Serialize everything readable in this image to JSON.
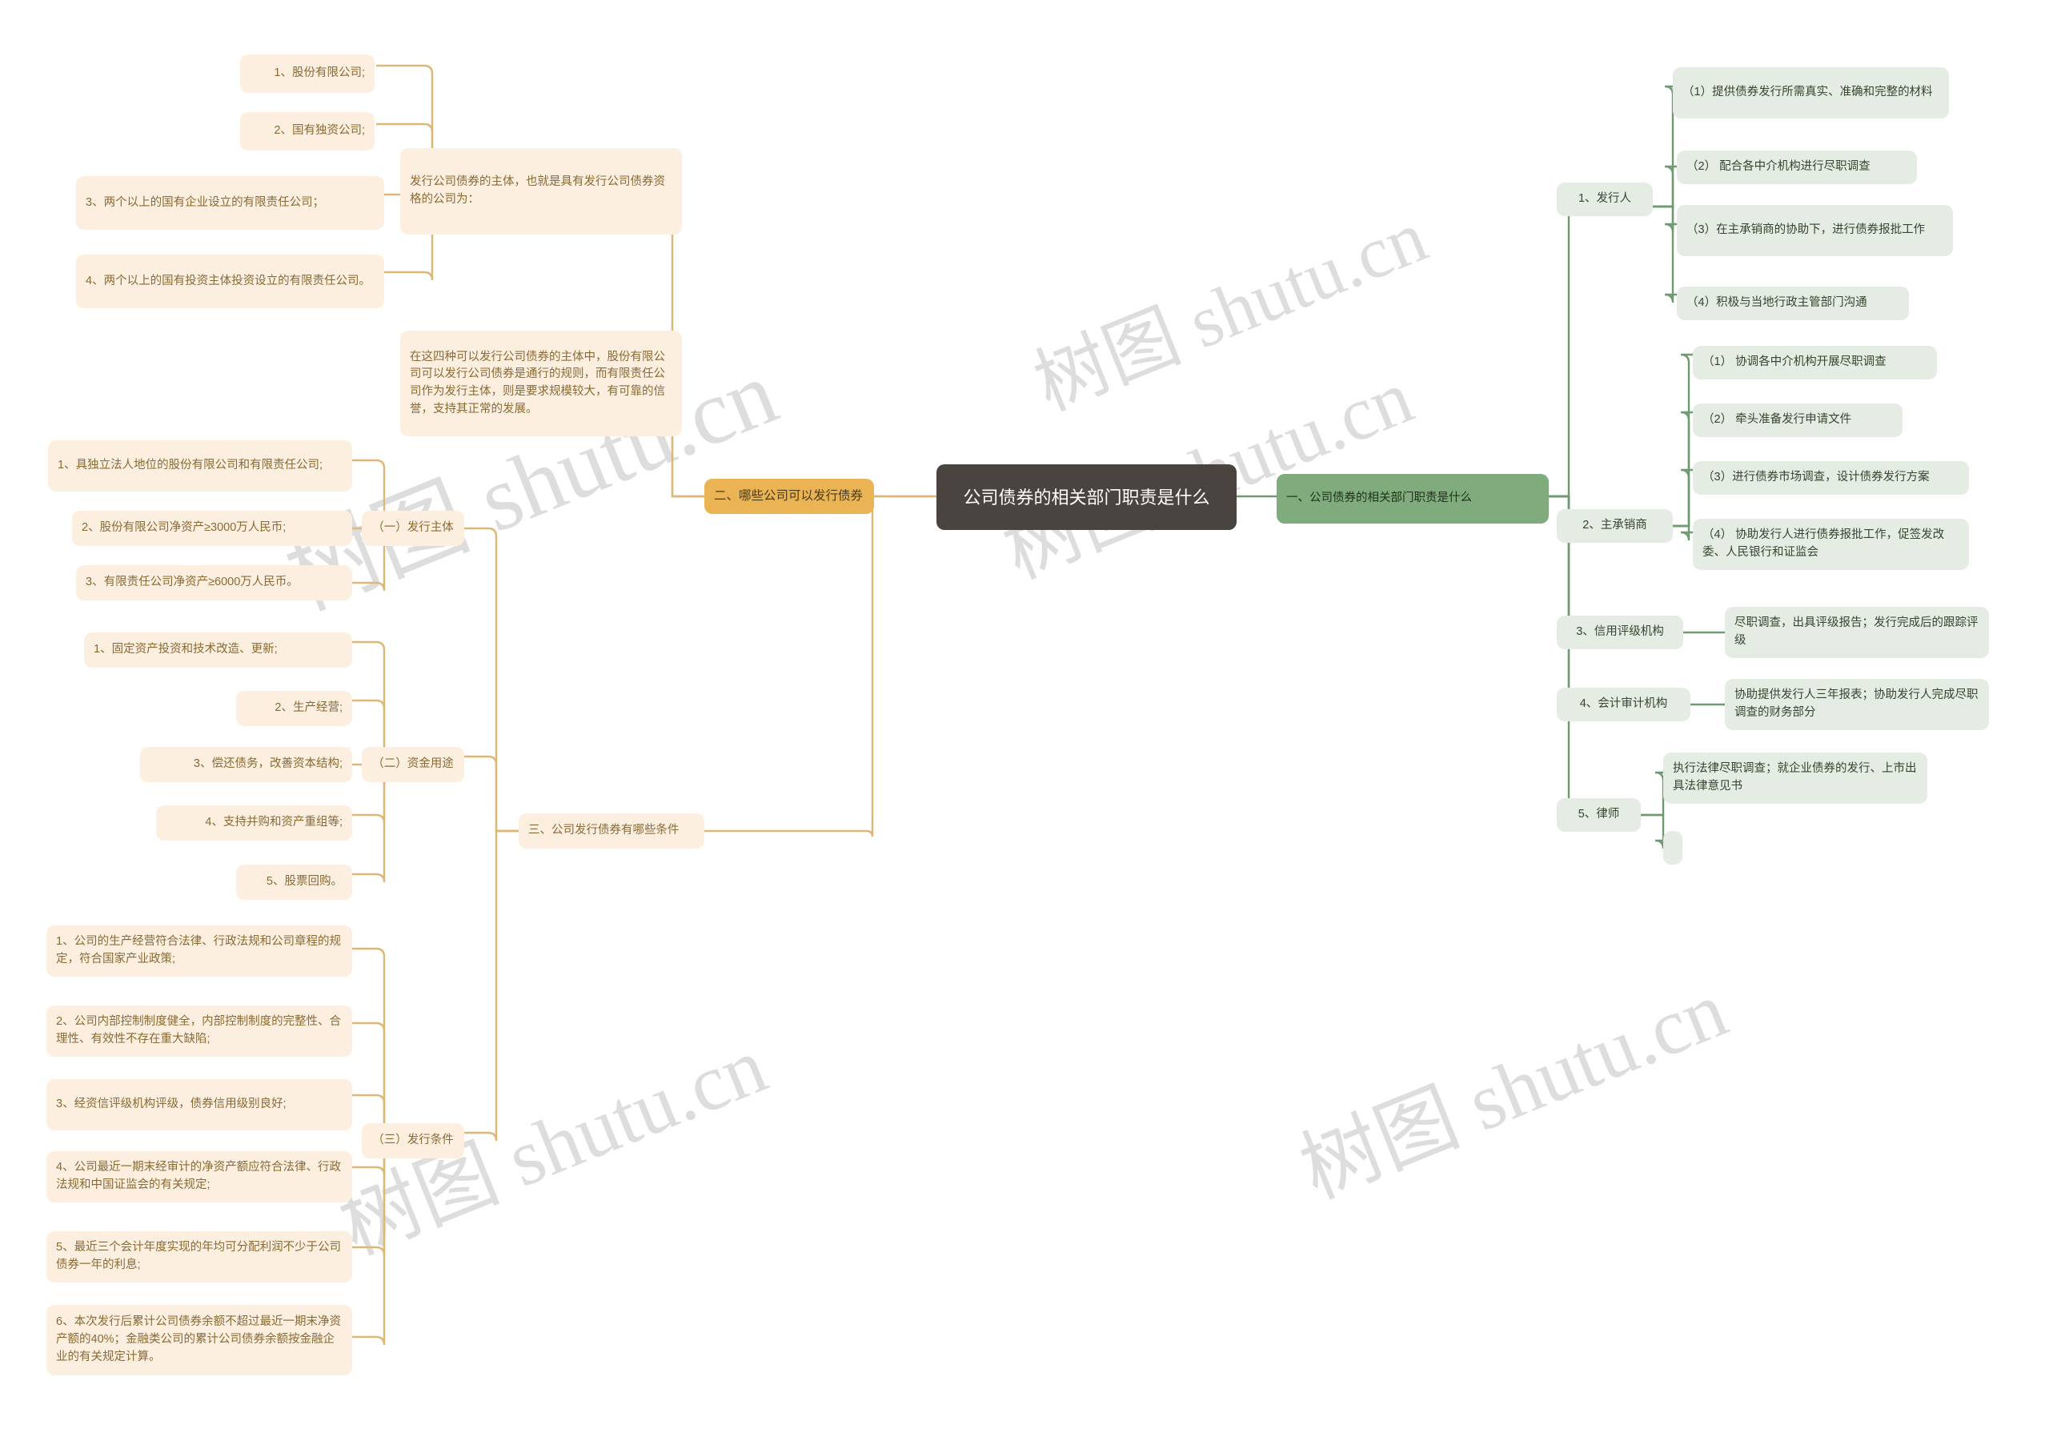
{
  "meta": {
    "watermark_text": "树图 shutu.cn"
  },
  "root": {
    "label": "公司债券的相关部门职责是什么"
  },
  "branches": {
    "left": {
      "label": "二、哪些公司可以发行债券",
      "label3": "三、公司发行债券有哪些条件",
      "subject_group": {
        "label": "发行公司债券的主体，也就是具有发行公司债券资格的公司为：",
        "items": [
          "1、股份有限公司;",
          "2、国有独资公司;",
          "3、两个以上的国有企业设立的有限责任公司；",
          "4、两个以上的国有投资主体投资设立的有限责任公司。"
        ],
        "note": "在这四种可以发行公司债券的主体中，股份有限公司可以发行公司债券是通行的规则，而有限责任公司作为发行主体，则是要求规模较大，有可靠的信誉，支持其正常的发展。"
      },
      "issuer_group": {
        "label": "（一）发行主体",
        "items": [
          "1、具独立法人地位的股份有限公司和有限责任公司;",
          "2、股份有限公司净资产≥3000万人民币;",
          "3、有限责任公司净资产≥6000万人民币。"
        ]
      },
      "funds_group": {
        "label": "（二）资金用途",
        "items": [
          "1、固定资产投资和技术改造、更新;",
          "2、生产经营;",
          "3、偿还债务，改善资本结构;",
          "4、支持并购和资产重组等;",
          "5、股票回购。"
        ]
      },
      "conditions_group": {
        "label": "（三）发行条件",
        "items": [
          "1、公司的生产经营符合法律、行政法规和公司章程的规定，符合国家产业政策;",
          "2、公司内部控制制度健全，内部控制制度的完整性、合理性、有效性不存在重大缺陷;",
          "3、经资信评级机构评级，债券信用级别良好;",
          "4、公司最近一期末经审计的净资产额应符合法律、行政法规和中国证监会的有关规定;",
          "5、最近三个会计年度实现的年均可分配利润不少于公司债券一年的利息;",
          "6、本次发行后累计公司债券余额不超过最近一期末净资产额的40%；金融类公司的累计公司债券余额按金融企业的有关规定计算。"
        ]
      }
    },
    "right": {
      "label": "一、公司债券的相关部门职责是什么",
      "groups": [
        {
          "label": "1、发行人",
          "items": [
            "（1）提供债券发行所需真实、准确和完整的材料",
            "（2） 配合各中介机构进行尽职调查",
            "（3）在主承销商的协助下，进行债券报批工作",
            "（4）积极与当地行政主管部门沟通"
          ]
        },
        {
          "label": "2、主承销商",
          "items": [
            "（1） 协调各中介机构开展尽职调查",
            "（2） 牵头准备发行申请文件",
            "（3）进行债券市场调查，设计债券发行方案",
            "（4） 协助发行人进行债券报批工作，促签发改委、人民银行和证监会"
          ]
        },
        {
          "label": "3、信用评级机构",
          "items": [
            "尽职调查，出具评级报告；发行完成后的跟踪评级"
          ]
        },
        {
          "label": "4、会计审计机构",
          "items": [
            "协助提供发行人三年报表；协助发行人完成尽职调查的财务部分"
          ]
        },
        {
          "label": "5、律师",
          "items": [
            "执行法律尽职调查；就企业债券的发行、上市出具法律意见书",
            ""
          ]
        }
      ]
    }
  },
  "colors": {
    "orange_light": "#fcefe0",
    "orange_solid": "#eab455",
    "orange_wire": "#dcb777",
    "green_light": "#e5ece3",
    "green_solid": "#7fab7d",
    "green_wire": "#6f9a71",
    "root_bg": "#4a4440",
    "watermark": "#d8d8d8"
  }
}
